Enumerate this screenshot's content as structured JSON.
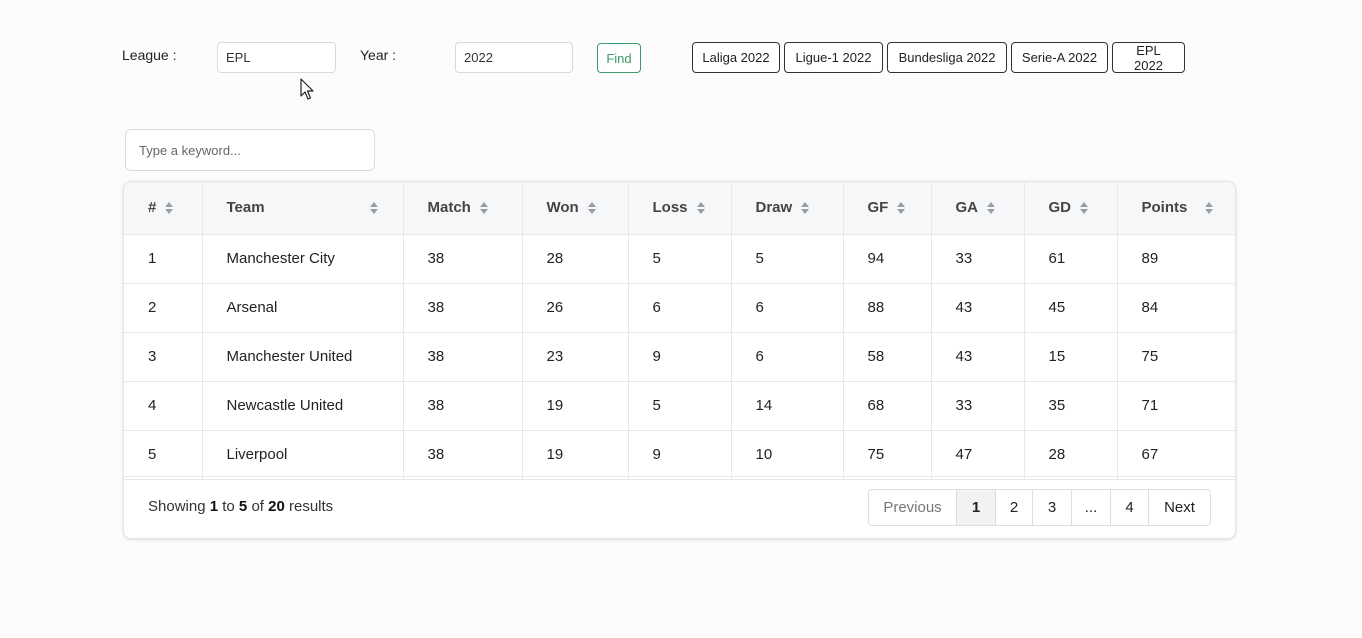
{
  "filters": {
    "league_label": "League :",
    "league_value": "EPL",
    "year_label": "Year :",
    "year_value": "2022",
    "find_label": "Find",
    "find_color": "#3d9a6a"
  },
  "presets": [
    "Laliga 2022",
    "Ligue-1 2022",
    "Bundesliga 2022",
    "Serie-A 2022",
    "EPL 2022"
  ],
  "search": {
    "placeholder": "Type a keyword..."
  },
  "table": {
    "columns": [
      "#",
      "Team",
      "Match",
      "Won",
      "Loss",
      "Draw",
      "GF",
      "GA",
      "GD",
      "Points"
    ],
    "rows": [
      [
        "1",
        "Manchester City",
        "38",
        "28",
        "5",
        "5",
        "94",
        "33",
        "61",
        "89"
      ],
      [
        "2",
        "Arsenal",
        "38",
        "26",
        "6",
        "6",
        "88",
        "43",
        "45",
        "84"
      ],
      [
        "3",
        "Manchester United",
        "38",
        "23",
        "9",
        "6",
        "58",
        "43",
        "15",
        "75"
      ],
      [
        "4",
        "Newcastle United",
        "38",
        "19",
        "5",
        "14",
        "68",
        "33",
        "35",
        "71"
      ],
      [
        "5",
        "Liverpool",
        "38",
        "19",
        "9",
        "10",
        "75",
        "47",
        "28",
        "67"
      ]
    ]
  },
  "footer": {
    "showing_prefix": "Showing",
    "from": "1",
    "to_word": "to",
    "to": "5",
    "of_word": "of",
    "total": "20",
    "suffix": "results"
  },
  "pagination": {
    "previous": "Previous",
    "pages": [
      "1",
      "2",
      "3",
      "...",
      "4"
    ],
    "active": "1",
    "next": "Next"
  }
}
